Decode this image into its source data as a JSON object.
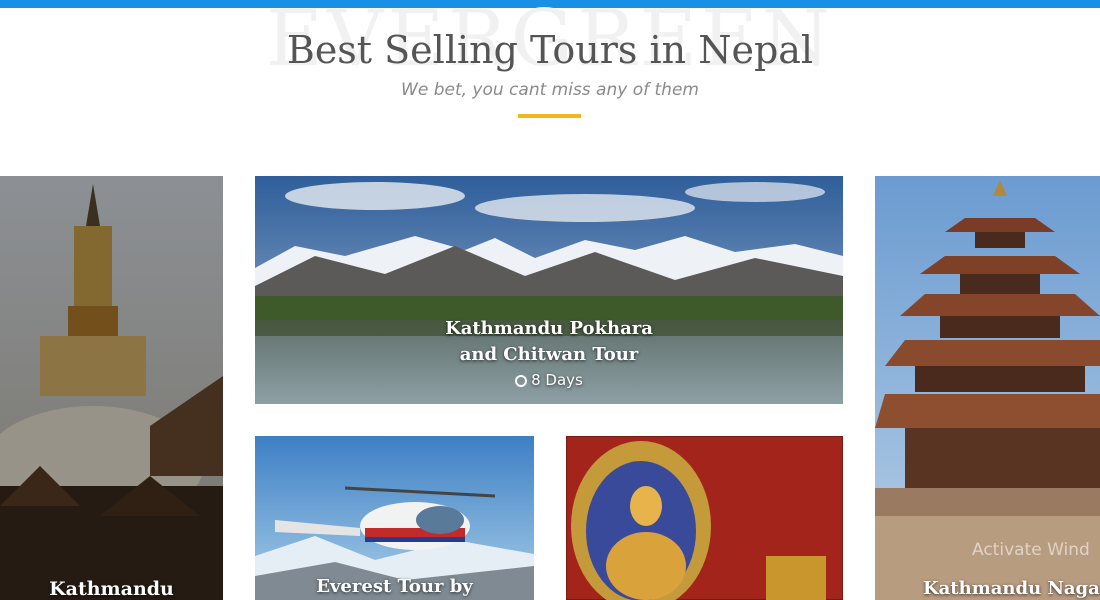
{
  "section": {
    "watermark": "EVERGREEN",
    "title": "Best Selling Tours in Nepal",
    "subtitle": "We bet, you cant miss any of them"
  },
  "tours": {
    "kathmandu": {
      "title": "Kathmandu"
    },
    "featured": {
      "title_line1": "Kathmandu Pokhara",
      "title_line2": "and Chitwan Tour",
      "duration": "8 Days"
    },
    "everest": {
      "title": "Everest Tour by"
    },
    "buddha": {
      "title": ""
    },
    "nagarkot": {
      "title": "Kathmandu Nagarkot"
    }
  },
  "system": {
    "watermark_text": "Activate Wind"
  },
  "colors": {
    "topbar": "#1a8fe6",
    "accent_underline": "#f0b81c",
    "heading_text": "#555555",
    "subtitle_text": "#8a8a8a"
  },
  "icons": {
    "duration": "clock-icon"
  }
}
